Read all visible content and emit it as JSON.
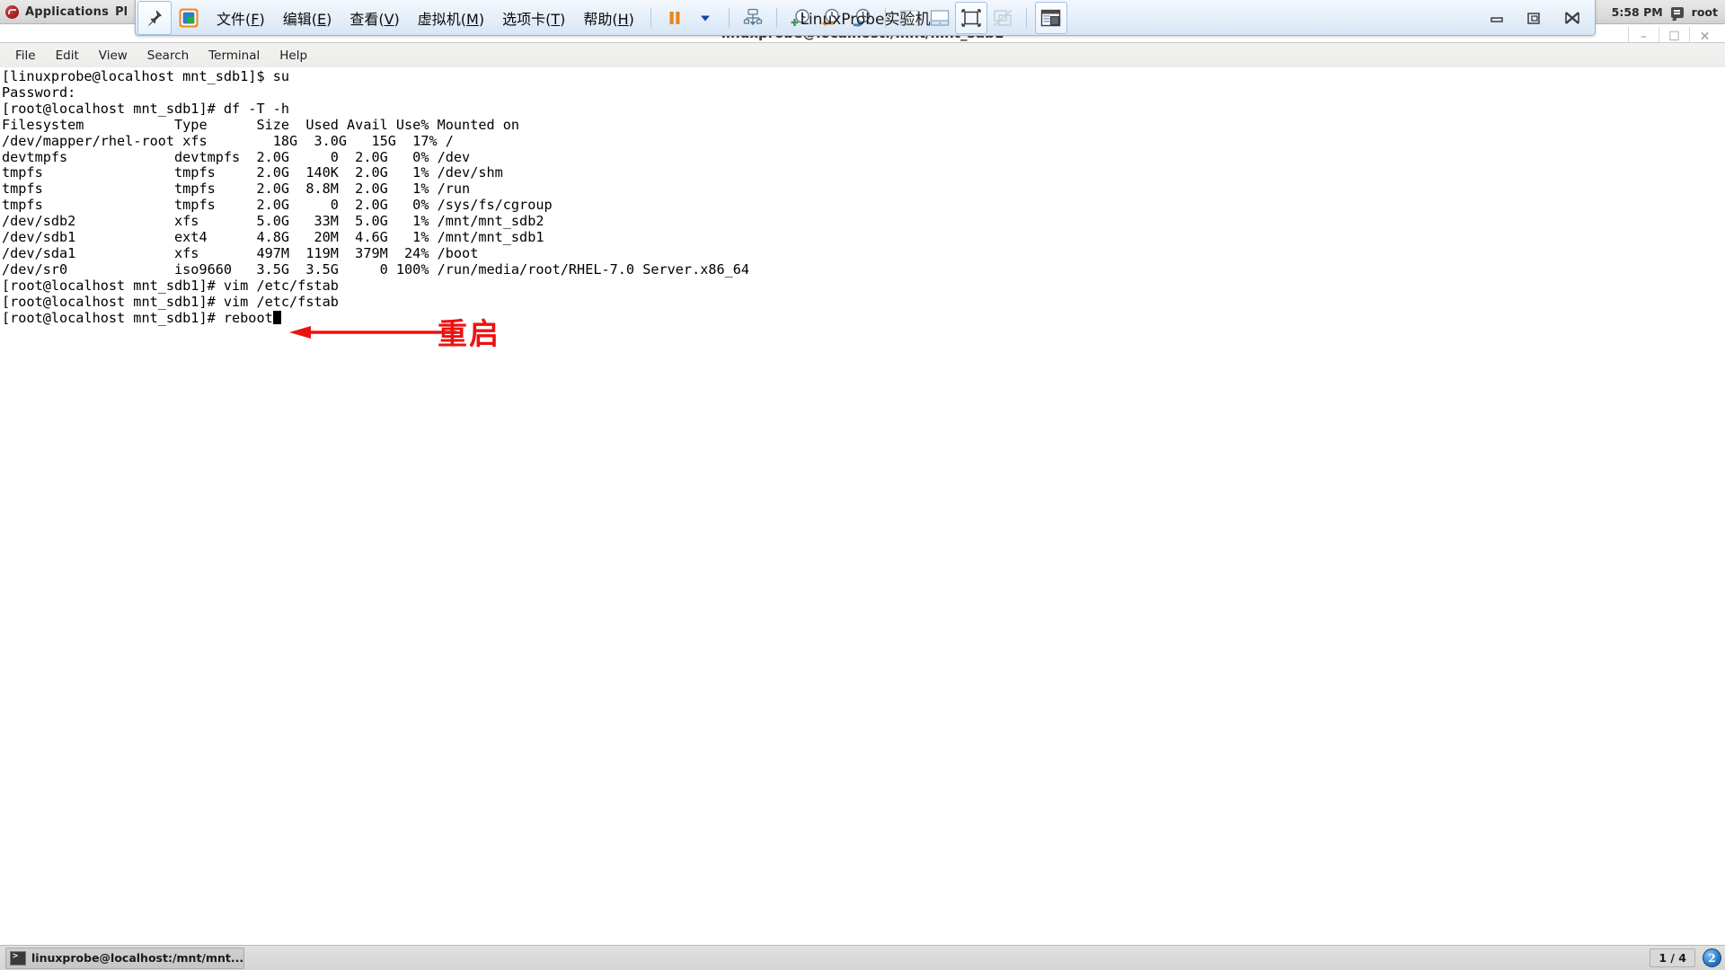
{
  "gnome_panel": {
    "applications_label": "Applications",
    "places_label": "Pl",
    "clock": "5:58 PM",
    "user": "root"
  },
  "vmware": {
    "window_title": "LinuxProbe实验机",
    "menu": [
      {
        "label": "文件(F)",
        "text": "文件(",
        "mnem": "F",
        "tail": ")"
      },
      {
        "label": "编辑(E)",
        "text": "编辑(",
        "mnem": "E",
        "tail": ")"
      },
      {
        "label": "查看(V)",
        "text": "查看(",
        "mnem": "V",
        "tail": ")"
      },
      {
        "label": "虚拟机(M)",
        "text": "虚拟机(",
        "mnem": "M",
        "tail": ")"
      },
      {
        "label": "选项卡(T)",
        "text": "选项卡(",
        "mnem": "T",
        "tail": ")"
      },
      {
        "label": "帮助(H)",
        "text": "帮助(",
        "mnem": "H",
        "tail": ")"
      }
    ],
    "toolbar_icons": [
      "pin-icon",
      "vmware-app-icon",
      "suspend-icon",
      "power-dropdown-icon",
      "send-ctrl-alt-del-icon",
      "snapshot-take-icon",
      "snapshot-revert-icon",
      "snapshot-manager-icon",
      "show-library-icon",
      "show-thumbnail-bar-icon",
      "full-screen-icon",
      "unity-mode-icon",
      "console-view-icon"
    ],
    "window_buttons": [
      "minimize-icon",
      "restore-icon",
      "close-icon"
    ]
  },
  "terminal_window": {
    "title": "linuxprobe@localhost:/mnt/mnt_sdb1",
    "inner_buttons": [
      "minimize",
      "maximize",
      "close"
    ],
    "menu": [
      "File",
      "Edit",
      "View",
      "Search",
      "Terminal",
      "Help"
    ],
    "lines": [
      "[linuxprobe@localhost mnt_sdb1]$ su",
      "Password:",
      "[root@localhost mnt_sdb1]# df -T -h",
      "Filesystem           Type      Size  Used Avail Use% Mounted on",
      "/dev/mapper/rhel-root xfs        18G  3.0G   15G  17% /",
      "devtmpfs             devtmpfs  2.0G     0  2.0G   0% /dev",
      "tmpfs                tmpfs     2.0G  140K  2.0G   1% /dev/shm",
      "tmpfs                tmpfs     2.0G  8.8M  2.0G   1% /run",
      "tmpfs                tmpfs     2.0G     0  2.0G   0% /sys/fs/cgroup",
      "/dev/sdb2            xfs       5.0G   33M  5.0G   1% /mnt/mnt_sdb2",
      "/dev/sdb1            ext4      4.8G   20M  4.6G   1% /mnt/mnt_sdb1",
      "/dev/sda1            xfs       497M  119M  379M  24% /boot",
      "/dev/sr0             iso9660   3.5G  3.5G     0 100% /run/media/root/RHEL-7.0 Server.x86_64",
      "[root@localhost mnt_sdb1]# vim /etc/fstab",
      "[root@localhost mnt_sdb1]# vim /etc/fstab"
    ],
    "last_prompt": "[root@localhost mnt_sdb1]# reboot"
  },
  "annotation": {
    "text": "重启",
    "color": "#ee1111",
    "arrow": "left-arrow"
  },
  "taskbar": {
    "task_title": "linuxprobe@localhost:/mnt/mnt...",
    "workspace": "1 / 4",
    "tray_badge": "2"
  }
}
